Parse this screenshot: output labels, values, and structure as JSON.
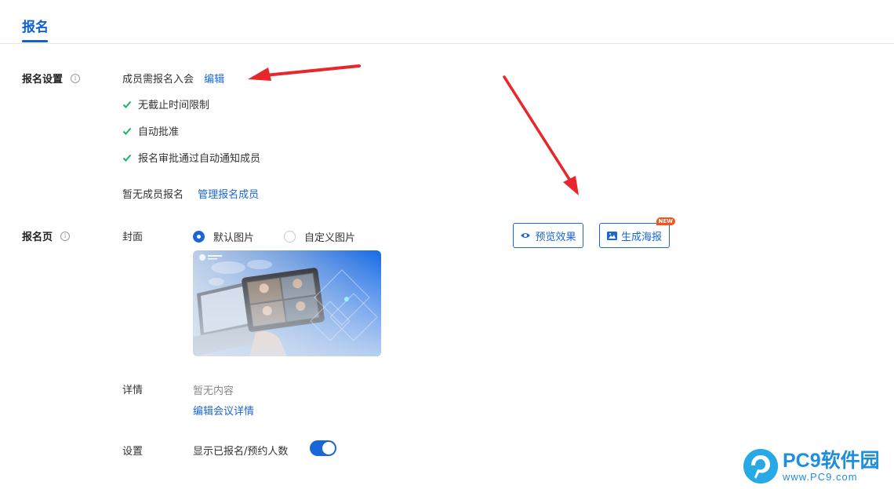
{
  "tabs": {
    "active": "报名"
  },
  "signup_settings": {
    "label": "报名设置",
    "info_icon": "i",
    "requirement": "成员需报名入会",
    "edit_link": "编辑",
    "checks": [
      "无截止时间限制",
      "自动批准",
      "报名审批通过自动通知成员"
    ],
    "no_members": "暂无成员报名",
    "manage_link": "管理报名成员",
    "check_color": "#19b45f"
  },
  "signup_page": {
    "label": "报名页",
    "info_icon": "i",
    "cover_label": "封面",
    "cover_options": {
      "default": "默认图片",
      "custom": "自定义图片",
      "selected": "默认图片"
    },
    "preview_button": "预览效果",
    "poster_button": "生成海报",
    "new_badge": "NEW",
    "details_label": "详情",
    "details_empty": "暂无内容",
    "edit_details_link": "编辑会议详情",
    "settings_label": "设置",
    "show_count_label": "显示已报名/预约人数",
    "show_count_enabled": true
  },
  "watermark": {
    "title": "PC9软件园",
    "url": "www.PC9.com"
  },
  "colors": {
    "accent": "#1a66d6",
    "arrow": "#e8262b",
    "badge": "#f2541b"
  }
}
